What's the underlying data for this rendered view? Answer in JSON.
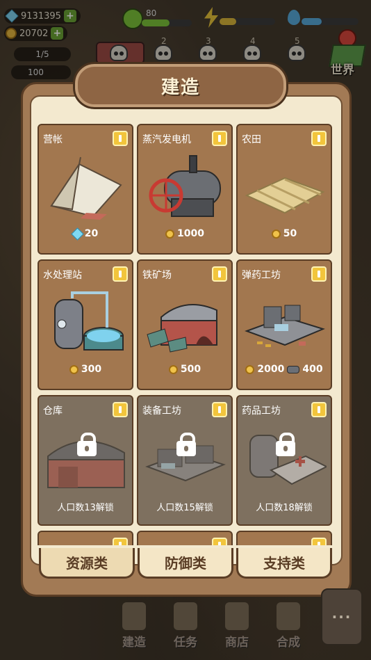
{
  "hud": {
    "gems": "9131395",
    "coins": "20702",
    "population": "1/5",
    "hundred": "100",
    "happiness": "80",
    "waves": [
      "2",
      "3",
      "4",
      "5"
    ],
    "world_label": "世界",
    "energy_fill": 0.3,
    "water_fill": 0.35
  },
  "modal": {
    "title": "建造",
    "buildings": [
      {
        "name": "营帐",
        "cost_type": "gem",
        "cost": "20",
        "locked": false,
        "icon": "tent-icon"
      },
      {
        "name": "蒸汽发电机",
        "cost_type": "coin",
        "cost": "1000",
        "locked": false,
        "icon": "steam-generator-icon"
      },
      {
        "name": "农田",
        "cost_type": "coin",
        "cost": "50",
        "locked": false,
        "icon": "farmland-icon"
      },
      {
        "name": "水处理站",
        "cost_type": "coin",
        "cost": "300",
        "locked": false,
        "icon": "water-station-icon"
      },
      {
        "name": "铁矿场",
        "cost_type": "coin",
        "cost": "500",
        "locked": false,
        "icon": "iron-mine-icon"
      },
      {
        "name": "弹药工坊",
        "cost_type": "coin",
        "cost": "2000",
        "cost2": "400",
        "locked": false,
        "icon": "ammo-workshop-icon"
      },
      {
        "name": "仓库",
        "unlock": "人口数13解锁",
        "locked": true,
        "icon": "warehouse-icon"
      },
      {
        "name": "装备工坊",
        "unlock": "人口数15解锁",
        "locked": true,
        "icon": "equipment-workshop-icon"
      },
      {
        "name": "药品工坊",
        "unlock": "人口数18解锁",
        "locked": true,
        "icon": "medicine-workshop-icon"
      }
    ],
    "tabs": [
      {
        "label": "资源类",
        "active": true
      },
      {
        "label": "防御类",
        "active": false
      },
      {
        "label": "支持类",
        "active": false
      }
    ]
  },
  "nav": {
    "build": "建造",
    "tasks": "任务",
    "shop": "商店",
    "craft": "合成",
    "more": "···"
  },
  "colors": {
    "modal_bg": "#a27a55",
    "panel_bg": "#f3e9cf",
    "card_bg": "#a2774f",
    "card_locked_bg": "#7e705f",
    "badge": "#f2c53c"
  }
}
